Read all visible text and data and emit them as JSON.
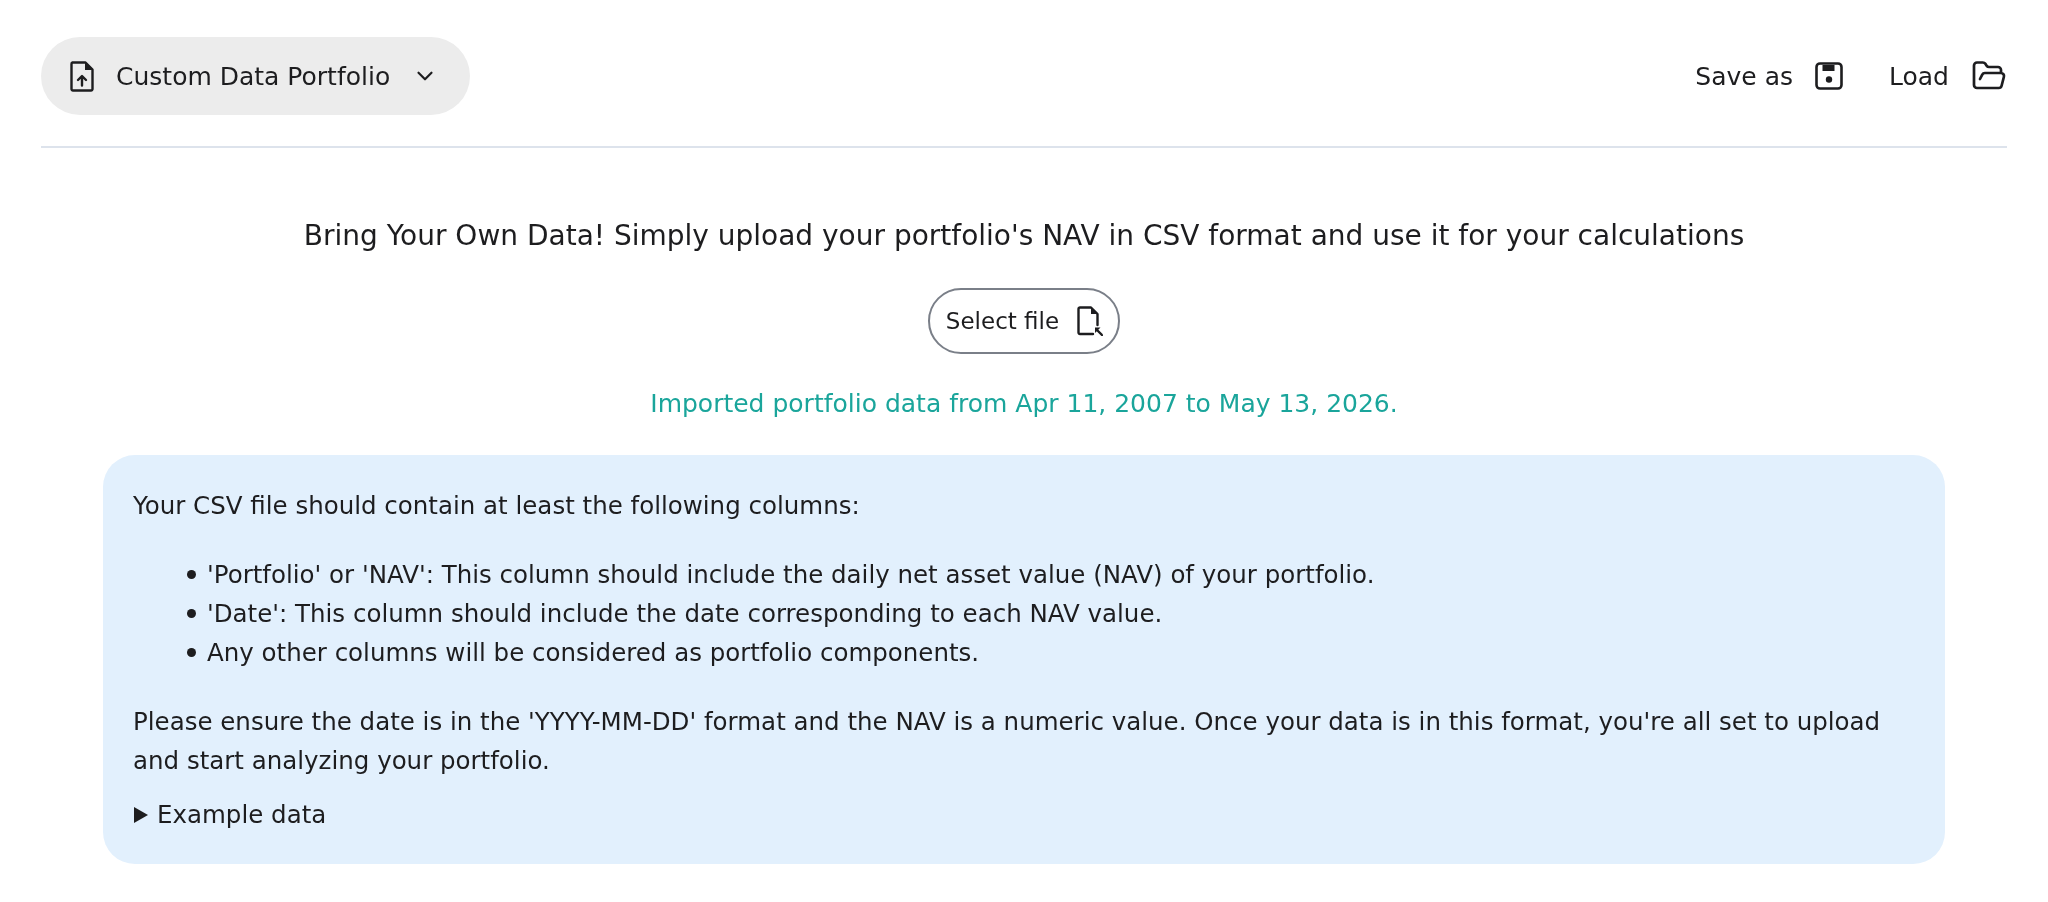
{
  "toolbar": {
    "portfolio_selector": {
      "label": "Custom Data Portfolio"
    },
    "actions": [
      {
        "kind": "save",
        "label": "Save as"
      },
      {
        "kind": "load",
        "label": "Load"
      }
    ]
  },
  "upload": {
    "headline": "Bring Your Own Data! Simply upload your portfolio's NAV in CSV format and use it for your calculations",
    "select_button": {
      "label": "Select file"
    },
    "status": "Imported portfolio data from Apr 11, 2007 to May 13, 2026."
  },
  "info_box": {
    "intro": "Your CSV file should contain at least the following columns:",
    "requirements": [
      "'Portfolio' or 'NAV': This column should include the daily net asset value (NAV) of your portfolio.",
      "'Date': This column should include the date corresponding to each NAV value.",
      "Any other columns will be considered as portfolio components."
    ],
    "note": "Please ensure the date is in the 'YYYY-MM-DD' format and the NAV is a numeric value. Once your data is in this format, you're all set to upload and start analyzing your portfolio.",
    "example_data": {
      "summary": "Example data",
      "expanded": false
    }
  }
}
